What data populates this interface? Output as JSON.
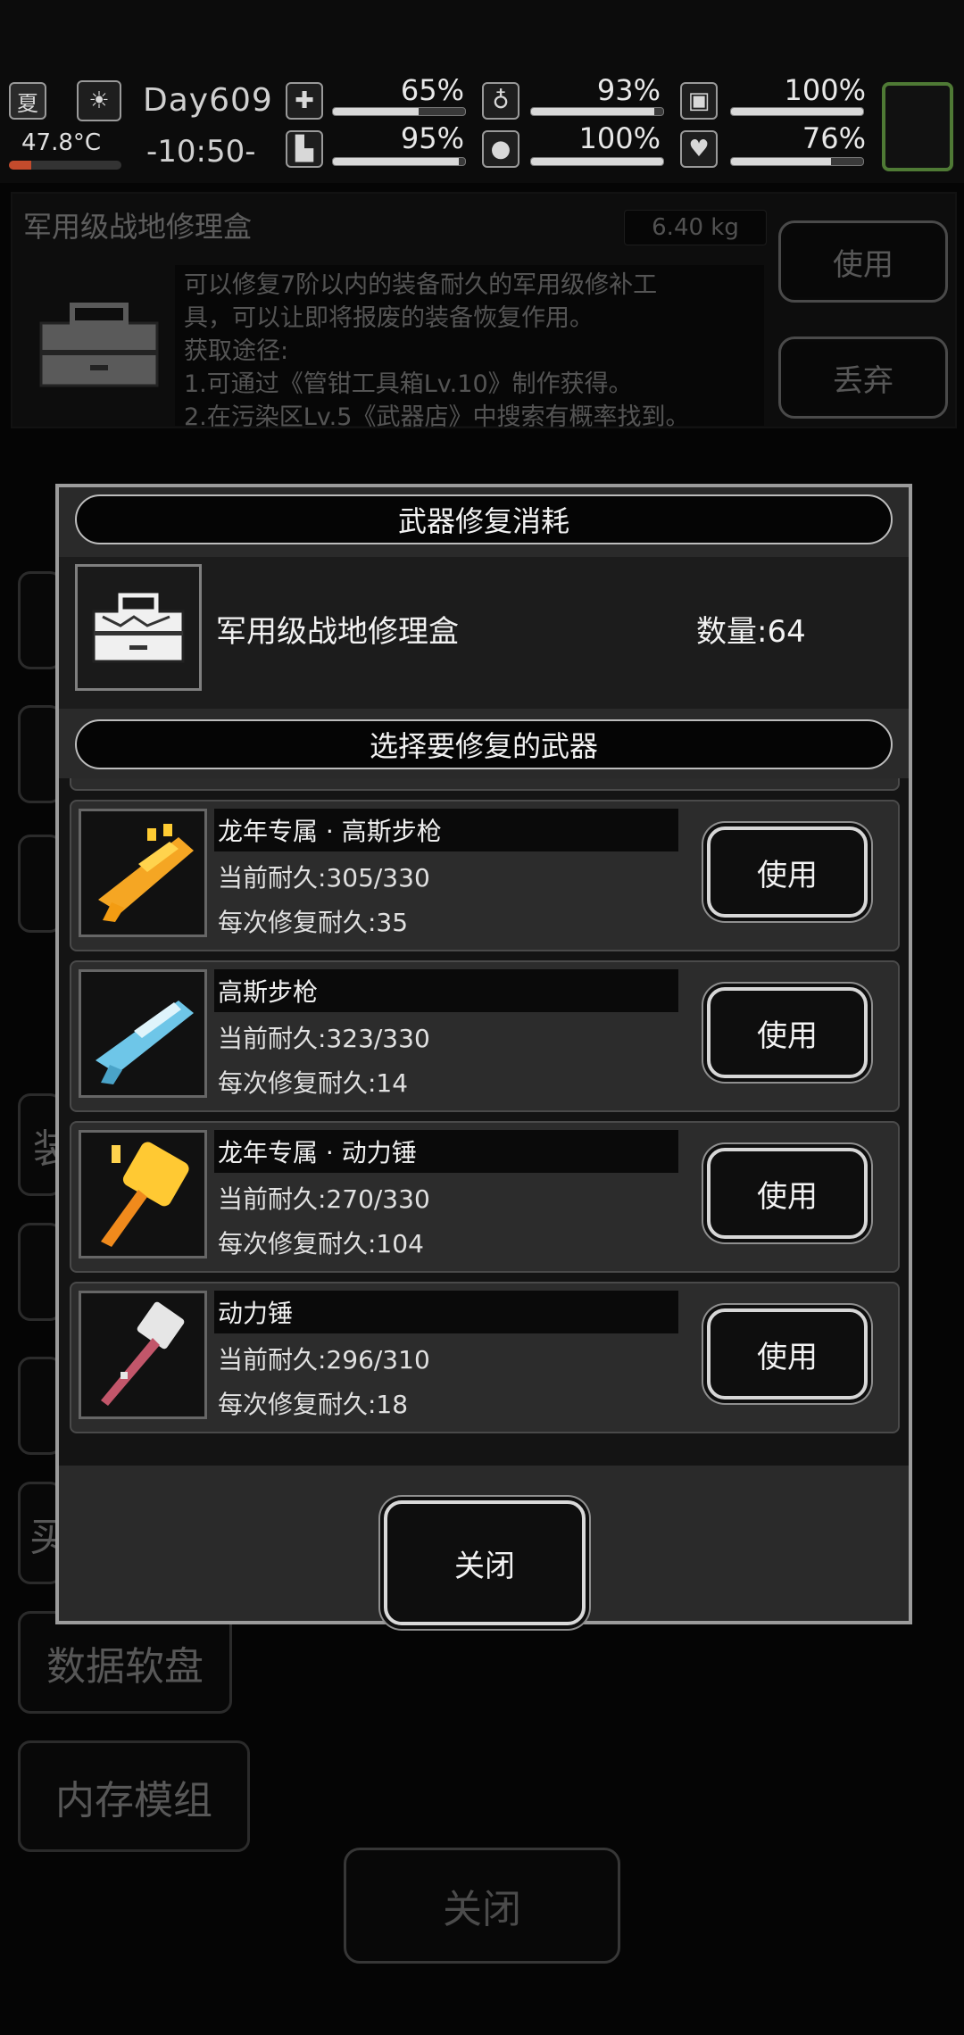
{
  "status": {
    "season": "夏",
    "weather_icon": "sun-icon",
    "temperature": "47.8°C",
    "temperature_level": 0.2,
    "day": "Day609",
    "time": "-10:50-",
    "stats": [
      {
        "icon": "health-icon",
        "glyph": "✚",
        "value": "65%",
        "level": 0.65
      },
      {
        "icon": "stomach-icon",
        "glyph": "♁",
        "value": "93%",
        "level": 0.93
      },
      {
        "icon": "energy-icon",
        "glyph": "▣",
        "value": "100%",
        "level": 1.0
      },
      {
        "icon": "boot-icon",
        "glyph": "▙",
        "value": "95%",
        "level": 0.95
      },
      {
        "icon": "water-drop-icon",
        "glyph": "●",
        "value": "100%",
        "level": 1.0
      },
      {
        "icon": "heart-icon",
        "glyph": "♥",
        "value": "76%",
        "level": 0.76
      }
    ]
  },
  "item": {
    "title": "军用级战地修理盒",
    "weight": "6.40 kg",
    "description": [
      "可以修复7阶以内的装备耐久的军用级修补工",
      "具，可以让即将报废的装备恢复作用。",
      "获取途径:",
      "1.可通过《管钳工具箱Lv.10》制作获得。",
      "2.在污染区Lv.5《武器店》中搜索有概率找到。"
    ],
    "use_label": "使用",
    "discard_label": "丢弃"
  },
  "sidebar": {
    "partial_1": "装",
    "partial_2": "买",
    "data_disk": "数据软盘",
    "memory_module": "内存模组"
  },
  "page_close_label": "关闭",
  "modal": {
    "cost_header": "武器修复消耗",
    "cost_item_name": "军用级战地修理盒",
    "cost_quantity": "数量:64",
    "select_header": "选择要修复的武器",
    "weapons": [
      {
        "name": "龙年专属 · 高斯步枪",
        "current": "当前耐久:305/330",
        "repair": "每次修复耐久:35",
        "use_label": "使用",
        "icon": "gold-gauss-rifle-icon"
      },
      {
        "name": "高斯步枪",
        "current": "当前耐久:323/330",
        "repair": "每次修复耐久:14",
        "use_label": "使用",
        "icon": "gauss-rifle-icon"
      },
      {
        "name": "龙年专属 · 动力锤",
        "current": "当前耐久:270/330",
        "repair": "每次修复耐久:104",
        "use_label": "使用",
        "icon": "gold-power-hammer-icon"
      },
      {
        "name": "动力锤",
        "current": "当前耐久:296/310",
        "repair": "每次修复耐久:18",
        "use_label": "使用",
        "icon": "power-hammer-icon"
      }
    ],
    "close_label": "关闭"
  }
}
